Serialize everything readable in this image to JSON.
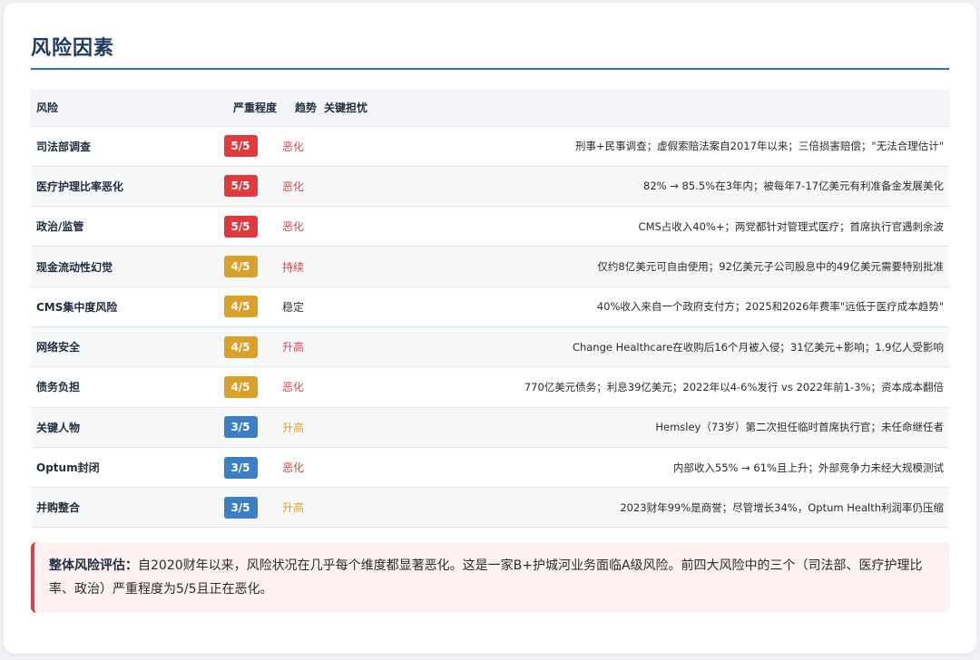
{
  "title": "风险因素",
  "headers": {
    "risk": "风险",
    "severity": "严重程度",
    "trend": "趋势",
    "concern": "关键担忧"
  },
  "colors": {
    "sev5": "#e0393e",
    "sev4": "#d9a02a",
    "sev3": "#3d7fc4",
    "trend_worse": "#d64545",
    "trend_up_amber": "#d9a02a",
    "trend_stable": "#333333"
  },
  "rows": [
    {
      "risk": "司法部调查",
      "severity": "5/5",
      "level": 5,
      "trend": "恶化",
      "trend_color": "#d64545",
      "concern": "刑事+民事调查；虚假索赔法案自2017年以来；三倍损害赔偿；\"无法合理估计\""
    },
    {
      "risk": "医疗护理比率恶化",
      "severity": "5/5",
      "level": 5,
      "trend": "恶化",
      "trend_color": "#d64545",
      "concern": "82% → 85.5%在3年内；被每年7-17亿美元有利准备金发展美化"
    },
    {
      "risk": "政治/监管",
      "severity": "5/5",
      "level": 5,
      "trend": "恶化",
      "trend_color": "#d64545",
      "concern": "CMS占收入40%+；两党都针对管理式医疗；首席执行官遇刺余波"
    },
    {
      "risk": "现金流动性幻觉",
      "severity": "4/5",
      "level": 4,
      "trend": "持续",
      "trend_color": "#d64545",
      "concern": "仅约8亿美元可自由使用；92亿美元子公司股息中的49亿美元需要特别批准"
    },
    {
      "risk": "CMS集中度风险",
      "severity": "4/5",
      "level": 4,
      "trend": "稳定",
      "trend_color": "#333333",
      "concern": "40%收入来自一个政府支付方；2025和2026年费率\"远低于医疗成本趋势\""
    },
    {
      "risk": "网络安全",
      "severity": "4/5",
      "level": 4,
      "trend": "升高",
      "trend_color": "#d64545",
      "concern": "Change Healthcare在收购后16个月被入侵；31亿美元+影响；1.9亿人受影响"
    },
    {
      "risk": "债务负担",
      "severity": "4/5",
      "level": 4,
      "trend": "恶化",
      "trend_color": "#d64545",
      "concern": "770亿美元债务；利息39亿美元；2022年以4-6%发行 vs 2022年前1-3%；资本成本翻倍"
    },
    {
      "risk": "关键人物",
      "severity": "3/5",
      "level": 3,
      "trend": "升高",
      "trend_color": "#d9a02a",
      "concern": "Hemsley（73岁）第二次担任临时首席执行官；未任命继任者"
    },
    {
      "risk": "Optum封闭",
      "severity": "3/5",
      "level": 3,
      "trend": "恶化",
      "trend_color": "#d64545",
      "concern": "内部收入55% → 61%且上升；外部竞争力未经大规模测试"
    },
    {
      "risk": "并购整合",
      "severity": "3/5",
      "level": 3,
      "trend": "升高",
      "trend_color": "#d9a02a",
      "concern": "2023财年99%是商誉；尽管增长34%，Optum Health利润率仍压缩"
    }
  ],
  "summary": {
    "label": "整体风险评估：",
    "text": "自2020财年以来，风险状况在几乎每个维度都显著恶化。这是一家B+护城河业务面临A级风险。前四大风险中的三个（司法部、医疗护理比率、政治）严重程度为5/5且正在恶化。"
  }
}
